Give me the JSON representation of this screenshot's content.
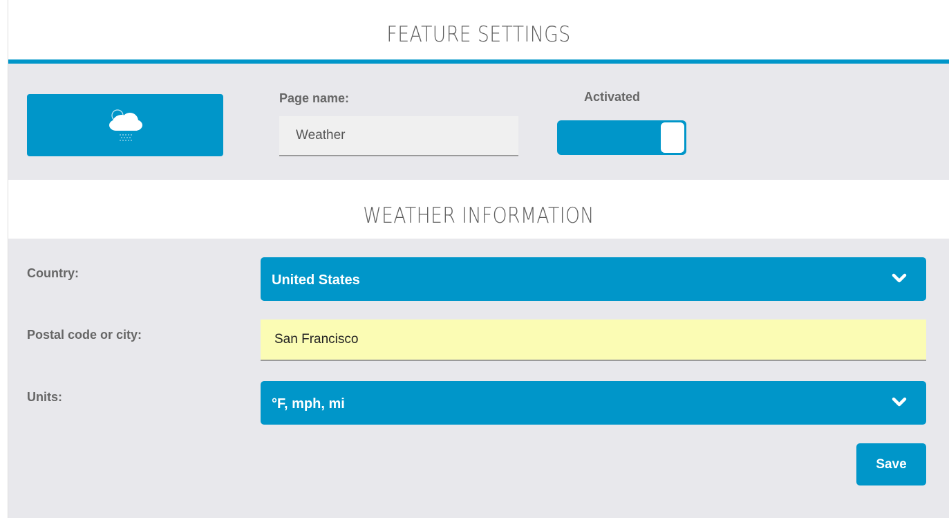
{
  "feature_settings": {
    "title": "FEATURE SETTINGS",
    "page_name_label": "Page name:",
    "page_name_value": "Weather",
    "activated_label": "Activated",
    "activated": true,
    "icon": "cloud-rain-icon"
  },
  "weather_information": {
    "title": "WEATHER INFORMATION",
    "country_label": "Country:",
    "country_value": "United States",
    "postal_label": "Postal code or city:",
    "postal_value": "San Francisco",
    "units_label": "Units:",
    "units_value": "°F, mph, mi",
    "save_label": "Save"
  },
  "colors": {
    "accent": "#0096c9",
    "panel": "#e8e8ec",
    "autofill": "#fbfcb4"
  }
}
